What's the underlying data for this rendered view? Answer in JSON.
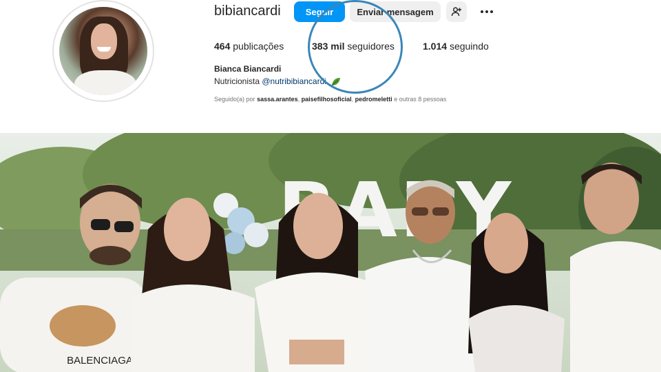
{
  "profile": {
    "username": "bibiancardi",
    "follow_label": "Seguir",
    "message_label": "Enviar mensagem",
    "suggest_icon": "person-plus-icon",
    "more_icon": "more-options-icon",
    "stats": {
      "posts_value": "464",
      "posts_label": "publicações",
      "followers_value": "383 mil",
      "followers_label": "seguidores",
      "following_value": "1.014",
      "following_label": "seguindo"
    },
    "full_name": "Bianca Biancardi",
    "bio_text": "Nutricionista",
    "bio_handle": "@nutribibiancardi",
    "bio_emoji_icon": "leaf-icon",
    "followed_by_prefix": "Seguido(a) por",
    "followed_by_users": [
      "sassa.arantes",
      "paisefilhosoficial",
      "pedromeletti"
    ],
    "followed_by_suffix": "e outras 8 pessoas"
  },
  "annotation": {
    "color": "#3a86b8"
  },
  "photo": {
    "sign_text": "BABY",
    "shirt_text": "BALENCIAGA"
  },
  "colors": {
    "primary_button": "#0095f6",
    "secondary_button": "#efefef",
    "link": "#00376b",
    "muted_text": "#737373"
  }
}
